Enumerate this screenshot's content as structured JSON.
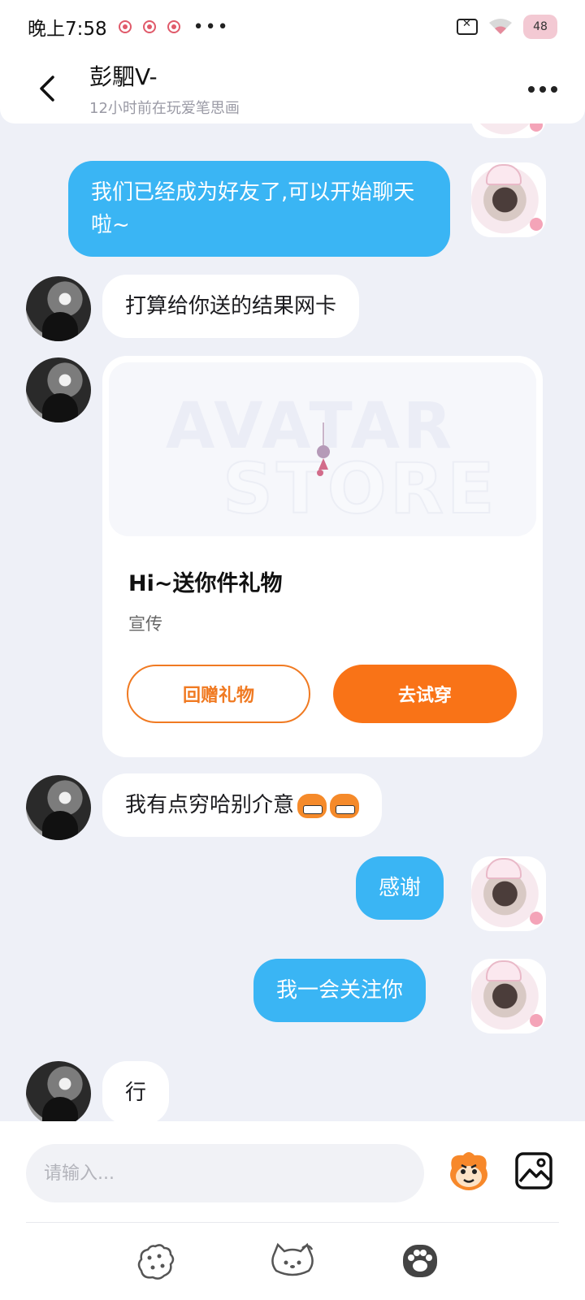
{
  "status_bar": {
    "time": "晚上7:58",
    "more": "•••",
    "battery": "48"
  },
  "header": {
    "contact_name": "彭駟V-",
    "contact_status": "12小时前在玩爱笔思画"
  },
  "messages": [
    {
      "side": "sent",
      "text": "我们已经成为好友了,可以开始聊天啦~"
    },
    {
      "side": "received",
      "text": "打算给你送的结果网卡"
    },
    {
      "side": "received",
      "text": "我有点穷哈别介意"
    },
    {
      "side": "sent",
      "text": "感谢"
    },
    {
      "side": "sent",
      "text": "我一会关注你"
    },
    {
      "side": "received",
      "text": "行"
    }
  ],
  "gift_card": {
    "banner_line1": "AVATAR",
    "banner_line2": "STORE",
    "title": "Hi~送你件礼物",
    "tag": "宣传",
    "return_gift_label": "回赠礼物",
    "try_on_label": "去试穿"
  },
  "input": {
    "placeholder": "请输入..."
  },
  "colors": {
    "sent_bubble": "#3ab5f4",
    "accent_orange": "#f97317",
    "background": "#eef0f7"
  },
  "icons": {
    "sticker": "monkey-sticker-icon",
    "image": "image-icon",
    "tabs": [
      "cookie-icon",
      "hello-kitty-icon",
      "paw-icon"
    ]
  }
}
